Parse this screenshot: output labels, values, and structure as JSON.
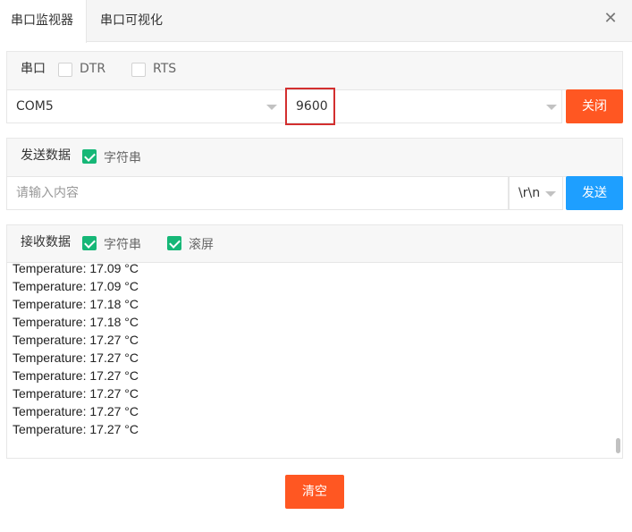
{
  "tabs": [
    {
      "label": "串口监视器",
      "active": true
    },
    {
      "label": "串口可视化",
      "active": false
    }
  ],
  "close_icon": "close-icon",
  "serial": {
    "title": "串口",
    "dtr": {
      "label": "DTR",
      "checked": false
    },
    "rts": {
      "label": "RTS",
      "checked": false
    },
    "port": "COM5",
    "baud": "9600",
    "close_button": "关闭"
  },
  "send": {
    "title": "发送数据",
    "string_mode": {
      "label": "字符串",
      "checked": true
    },
    "placeholder": "请输入内容",
    "line_ending": "\\r\\n",
    "send_button": "发送"
  },
  "receive": {
    "title": "接收数据",
    "string_mode": {
      "label": "字符串",
      "checked": true
    },
    "auto_scroll": {
      "label": "滚屏",
      "checked": true
    },
    "lines": [
      "Temperature: 17.09 °C",
      "Temperature: 17.09 °C",
      "Temperature: 17.18 °C",
      "Temperature: 17.18 °C",
      "Temperature: 17.27 °C",
      "Temperature: 17.27 °C",
      "Temperature: 17.27 °C",
      "Temperature: 17.27 °C",
      "Temperature: 17.27 °C",
      "Temperature: 17.27 °C"
    ]
  },
  "clear_button": "清空",
  "colors": {
    "orange": "#ff5722",
    "blue": "#1e9fff",
    "green": "#16b777",
    "highlight": "#d32f2f"
  }
}
